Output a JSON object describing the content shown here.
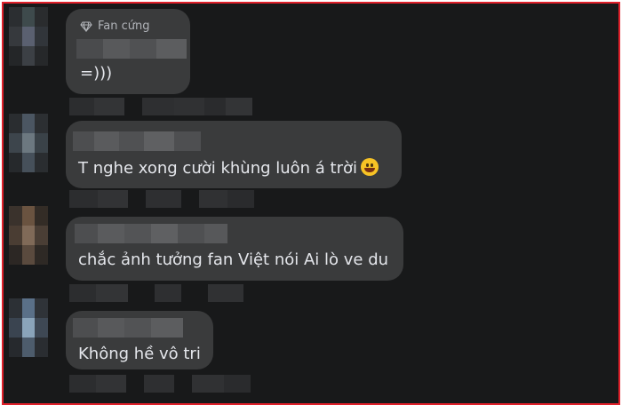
{
  "comments": [
    {
      "badge": "Fan cứng",
      "text": "=)))"
    },
    {
      "text": "T nghe xong cười khùng luôn á trời"
    },
    {
      "text": "chắc ảnh tưởng fan Việt nói Ai lò ve du"
    },
    {
      "text": "Không hề vô tri"
    }
  ],
  "icons": {
    "badge": "diamond-icon",
    "emoji": "grinning-face-emoji"
  },
  "colors": {
    "background": "#18191a",
    "bubble": "#3a3b3c",
    "text": "#e4e6eb",
    "frame_border": "#e0202a"
  }
}
